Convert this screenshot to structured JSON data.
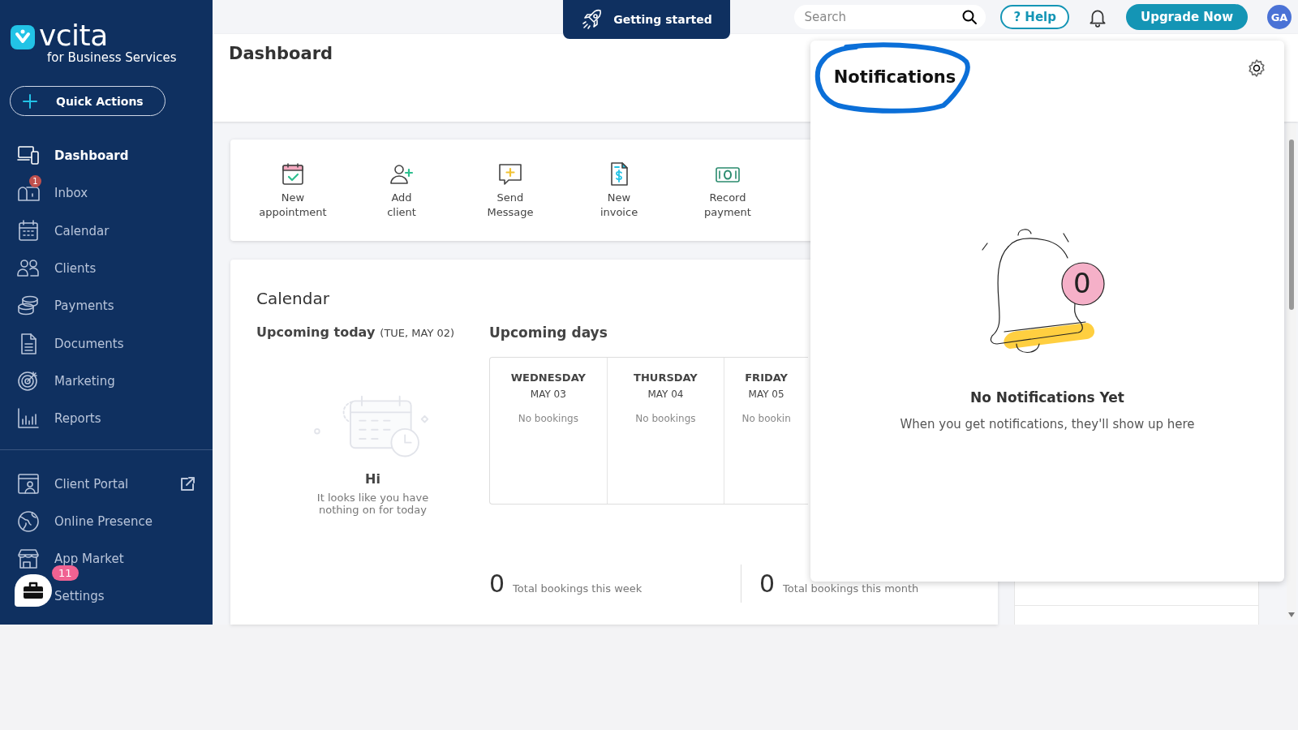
{
  "sidebar": {
    "logo": {
      "wordmark": "vcita",
      "tagline": "for Business Services"
    },
    "quick_actions": "Quick Actions",
    "nav": [
      {
        "label": "Dashboard",
        "selected": true
      },
      {
        "label": "Inbox",
        "selected": false,
        "badge": "1"
      },
      {
        "label": "Calendar",
        "selected": false
      },
      {
        "label": "Clients",
        "selected": false
      },
      {
        "label": "Payments",
        "selected": false
      },
      {
        "label": "Documents",
        "selected": false
      },
      {
        "label": "Marketing",
        "selected": false
      },
      {
        "label": "Reports",
        "selected": false
      }
    ],
    "nav_secondary": [
      {
        "label": "Client Portal",
        "selected": false,
        "external": true
      },
      {
        "label": "Online Presence",
        "selected": false,
        "external": false
      },
      {
        "label": "App Market",
        "selected": false,
        "external": false
      },
      {
        "label": "Settings",
        "selected": false,
        "external": false
      }
    ]
  },
  "help_widget": {
    "badge": "11"
  },
  "topbar": {
    "getting_started": "Getting started",
    "search": {
      "placeholder": "Search"
    },
    "help": "? Help",
    "upgrade": "Upgrade Now",
    "avatar": "GA"
  },
  "page_title": "Dashboard",
  "quick_actions": [
    {
      "kind": "appointment",
      "label": "New appointment"
    },
    {
      "kind": "client",
      "label": "Add client"
    },
    {
      "kind": "message",
      "label": "Send Message"
    },
    {
      "kind": "invoice",
      "label": "New invoice"
    },
    {
      "kind": "payment",
      "label": "Record payment"
    }
  ],
  "calendar": {
    "title": "Calendar",
    "today_label": "Upcoming today",
    "today_date": "(TUE,  MAY 02)",
    "empty_title": "Hi",
    "empty_text": "It looks like you have nothing on for today",
    "upcoming_title": "Upcoming days",
    "days": [
      {
        "day": "WEDNESDAY",
        "date": "MAY 03",
        "status": "No bookings"
      },
      {
        "day": "THURSDAY",
        "date": "MAY 04",
        "status": "No bookings"
      },
      {
        "day": "FRIDAY",
        "date": "MAY 05",
        "status": "No bookin"
      }
    ],
    "totals": [
      {
        "count": "0",
        "label": "Total bookings this week"
      },
      {
        "count": "0",
        "label": "Total bookings this month"
      }
    ]
  },
  "notifications": {
    "title": "Notifications",
    "illustration_count": "0",
    "empty_title": "No Notifications Yet",
    "empty_text": "When you get notifications, they'll show up here"
  }
}
